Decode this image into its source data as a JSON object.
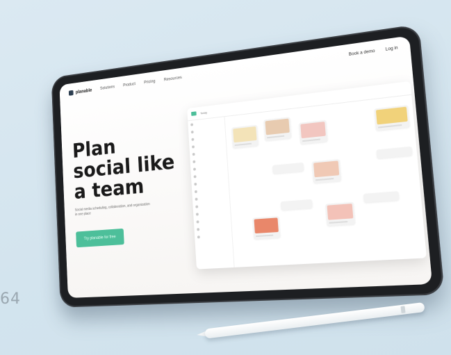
{
  "corner_number": "64",
  "screen": {
    "nav": {
      "logo_text": "planable",
      "items": [
        "Solutions",
        "Product",
        "Pricing",
        "Resources"
      ],
      "right": [
        "Book a demo",
        "Log in"
      ]
    },
    "hero": {
      "title": "Plan\nsocial like\na team",
      "subtitle": "Social media scheduling, collaboration, and organization in one place",
      "cta": "Try planable for free"
    },
    "app": {
      "top_label": "Today"
    }
  },
  "colors": {
    "accent": "#4dbf9a",
    "background": "#d3e4ee",
    "tablet_frame": "#1d1f22"
  }
}
